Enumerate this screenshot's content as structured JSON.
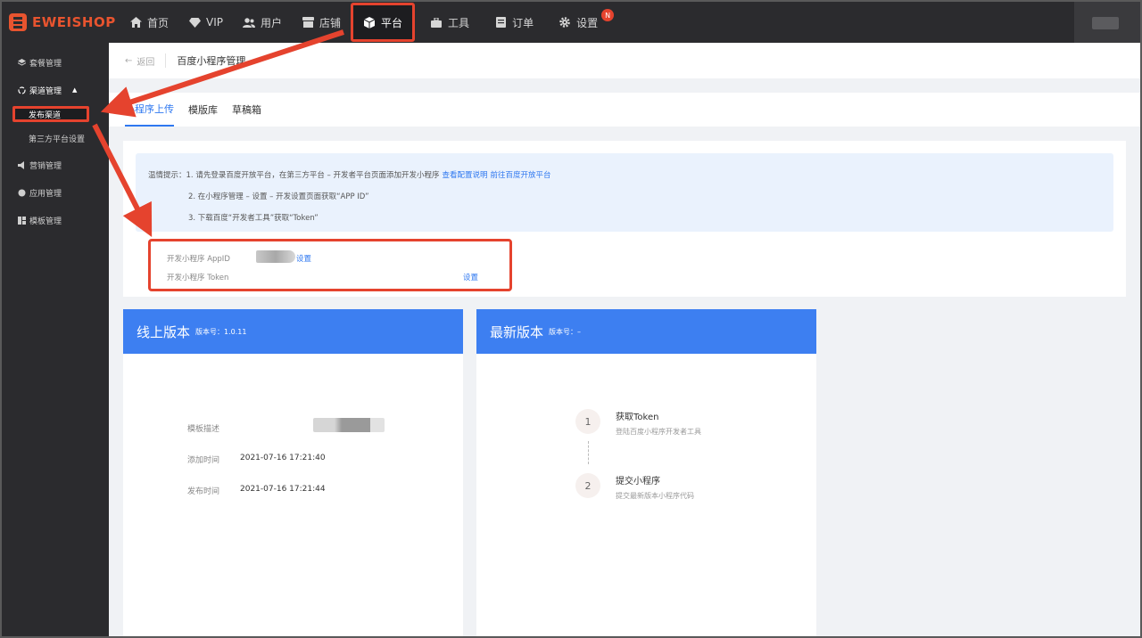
{
  "brand": "EWEISHOP",
  "nav": {
    "items": [
      {
        "label": "首页",
        "icon": "home-icon"
      },
      {
        "label": "VIP",
        "icon": "diamond-icon"
      },
      {
        "label": "用户",
        "icon": "users-icon"
      },
      {
        "label": "店铺",
        "icon": "store-icon"
      },
      {
        "label": "平台",
        "icon": "cube-icon"
      },
      {
        "label": "工具",
        "icon": "toolbox-icon"
      },
      {
        "label": "订单",
        "icon": "order-icon"
      },
      {
        "label": "设置",
        "icon": "gear-icon"
      }
    ],
    "active": "平台",
    "settings_badge": "N"
  },
  "sidebar": {
    "items": [
      {
        "label": "套餐管理"
      },
      {
        "label": "渠道管理"
      },
      {
        "label": "营销管理"
      },
      {
        "label": "应用管理"
      },
      {
        "label": "模板管理"
      }
    ],
    "sub_items": [
      {
        "label": "发布渠道"
      },
      {
        "label": "第三方平台设置"
      }
    ]
  },
  "breadcrumb": {
    "back": "返回",
    "title": "百度小程序管理"
  },
  "tabs": [
    "小程序上传",
    "模版库",
    "草稿箱"
  ],
  "tip": {
    "prefix": "温情提示：",
    "line1": "1. 请先登录百度开放平台，在第三方平台 – 开发者平台页面添加开发小程序",
    "link1": "查看配置说明",
    "link2": "前往百度开放平台",
    "line2": "2. 在小程序管理 – 设置 – 开发设置页面获取“APP ID”",
    "line3": "3. 下载百度“开发者工具”获取“Token”"
  },
  "config": {
    "appid_label": "开发小程序 AppID",
    "token_label": "开发小程序 Token",
    "set_label": "设置"
  },
  "online": {
    "title": "线上版本",
    "version_label": "版本号：1.0.11",
    "desc_label": "模板描述",
    "add_label": "添加时间",
    "add_time": "2021-07-16 17:21:40",
    "pub_label": "发布时间",
    "pub_time": "2021-07-16 17:21:44"
  },
  "latest": {
    "title": "最新版本",
    "version_label": "版本号：–",
    "steps": [
      {
        "num": "1",
        "title": "获取Token",
        "desc": "登陆百度小程序开发者工具"
      },
      {
        "num": "2",
        "title": "提交小程序",
        "desc": "提交最新版本小程序代码"
      }
    ]
  },
  "colors": {
    "accent": "#2f78f0",
    "annotation": "#e5432e",
    "card_header": "#3d7ff1"
  }
}
